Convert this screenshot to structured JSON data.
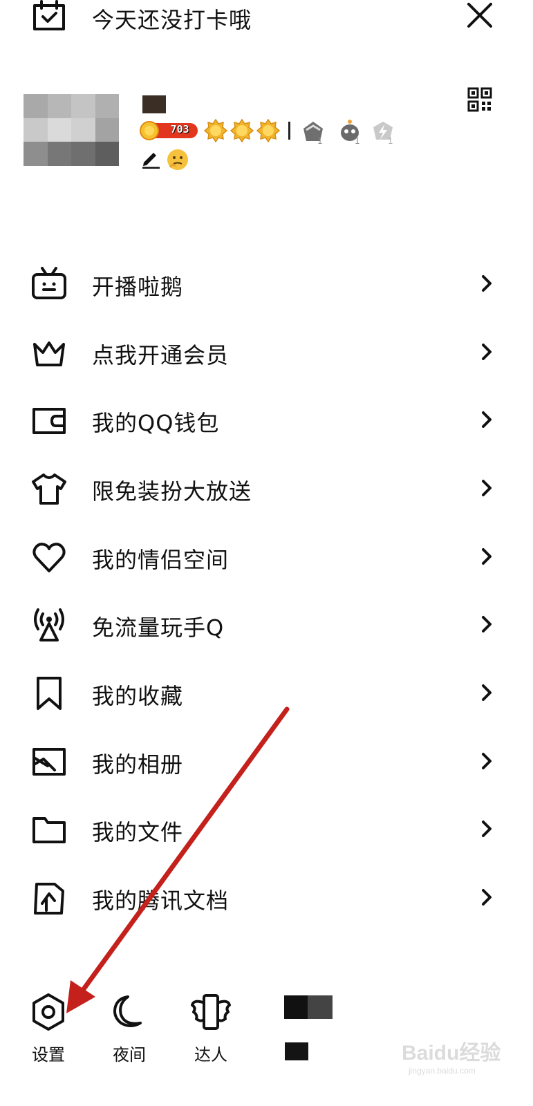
{
  "header": {
    "checkin_text": "今天还没打卡哦"
  },
  "profile": {
    "coin_count": "703"
  },
  "menu": [
    {
      "label": "开播啦鹅",
      "icon": "tv-icon"
    },
    {
      "label": "点我开通会员",
      "icon": "crown-icon"
    },
    {
      "label": "我的QQ钱包",
      "icon": "wallet-icon"
    },
    {
      "label": "限免装扮大放送",
      "icon": "tshirt-icon"
    },
    {
      "label": "我的情侣空间",
      "icon": "heart-icon"
    },
    {
      "label": "免流量玩手Q",
      "icon": "signal-tower-icon"
    },
    {
      "label": "我的收藏",
      "icon": "bookmark-icon"
    },
    {
      "label": "我的相册",
      "icon": "image-icon"
    },
    {
      "label": "我的文件",
      "icon": "folder-icon"
    },
    {
      "label": "我的腾讯文档",
      "icon": "doc-icon"
    }
  ],
  "bottom": {
    "settings_label": "设置",
    "night_label": "夜间",
    "talent_label": "达人"
  },
  "watermark": {
    "brand": "Baidu经验",
    "url": "jingyan.baidu.com"
  },
  "colors": {
    "accent_arrow": "#c4211c",
    "coin_badge": "#e2361f",
    "gold": "#f1b52c"
  }
}
